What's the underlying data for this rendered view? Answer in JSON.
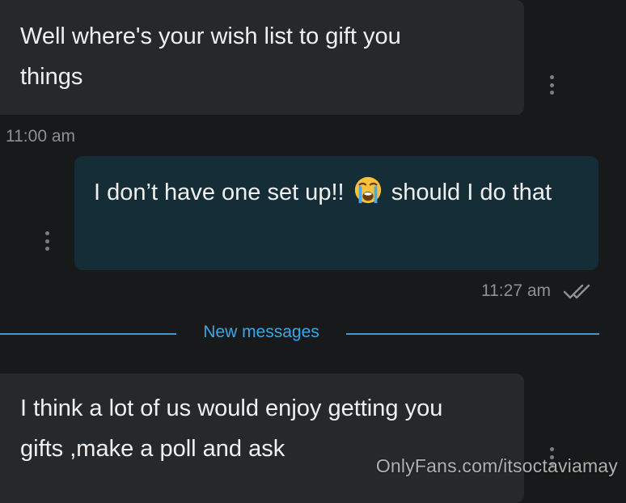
{
  "messages": [
    {
      "text": "Well where's your wish list to gift you things",
      "time": "11:00 am"
    },
    {
      "text_before_emoji": "I don’t have one set up!!",
      "emoji": "loudly-crying-face-icon",
      "text_after_emoji": "should I do that",
      "time": "11:27 am",
      "status": "read"
    },
    {
      "text": "I think a lot of us would enjoy getting you gifts ,make a poll and ask"
    }
  ],
  "divider": {
    "label": "New messages"
  },
  "watermark": "OnlyFans.com/itsoctaviamay",
  "colors": {
    "background": "#18191a",
    "incoming_bubble": "#26292b",
    "outgoing_bubble": "#152d36",
    "accent": "#3aa6e6"
  }
}
